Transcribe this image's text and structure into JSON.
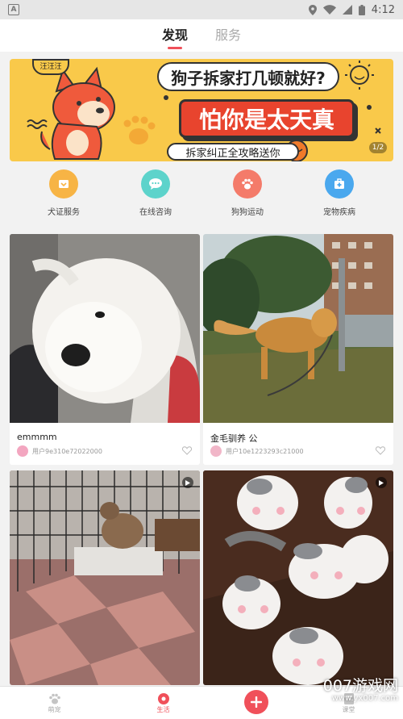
{
  "status_bar": {
    "app_icon_letter": "A",
    "time": "4:12"
  },
  "tabs": [
    {
      "label": "发现",
      "active": true
    },
    {
      "label": "服务",
      "active": false
    }
  ],
  "banner": {
    "bubble_text": "汪汪汪",
    "line1": "狗子拆家打几顿就好?",
    "line2": "怕你是太天真",
    "line3": "拆家纠正全攻略送你",
    "indicator": "1/2"
  },
  "services": [
    {
      "label": "犬证服务",
      "icon": "certificate-icon",
      "color": "#f7b445"
    },
    {
      "label": "在线咨询",
      "icon": "chat-bubble-icon",
      "color": "#5dd3cb"
    },
    {
      "label": "狗狗运动",
      "icon": "paw-icon",
      "color": "#f47b6a"
    },
    {
      "label": "宠物疾病",
      "icon": "medical-kit-icon",
      "color": "#4aa8ee"
    }
  ],
  "posts": [
    {
      "title": "emmmm",
      "user": "用户9e310e72022000",
      "media": "image",
      "subject": "samoyed-dog-photo"
    },
    {
      "title": "金毛驯养 公",
      "user": "用户10e1223293c21000",
      "media": "image",
      "subject": "golden-retriever-photo"
    },
    {
      "title": "",
      "user": "",
      "media": "video",
      "subject": "dog-in-cage-photo"
    },
    {
      "title": "",
      "user": "",
      "media": "video",
      "subject": "kittens-photo"
    }
  ],
  "bottom_nav": [
    {
      "label": "萌宠",
      "icon": "paw-icon",
      "active": false
    },
    {
      "label": "生活",
      "icon": "life-icon",
      "active": true
    },
    {
      "label": "",
      "icon": "plus-icon",
      "active": false
    },
    {
      "label": "课堂",
      "icon": "book-icon",
      "active": false
    }
  ],
  "watermark": {
    "brand": "007游戏网",
    "url": "www.yx007.com"
  },
  "colors": {
    "accent": "#f0505a",
    "banner_bg": "#f9c94a",
    "banner_red": "#e8442e"
  }
}
